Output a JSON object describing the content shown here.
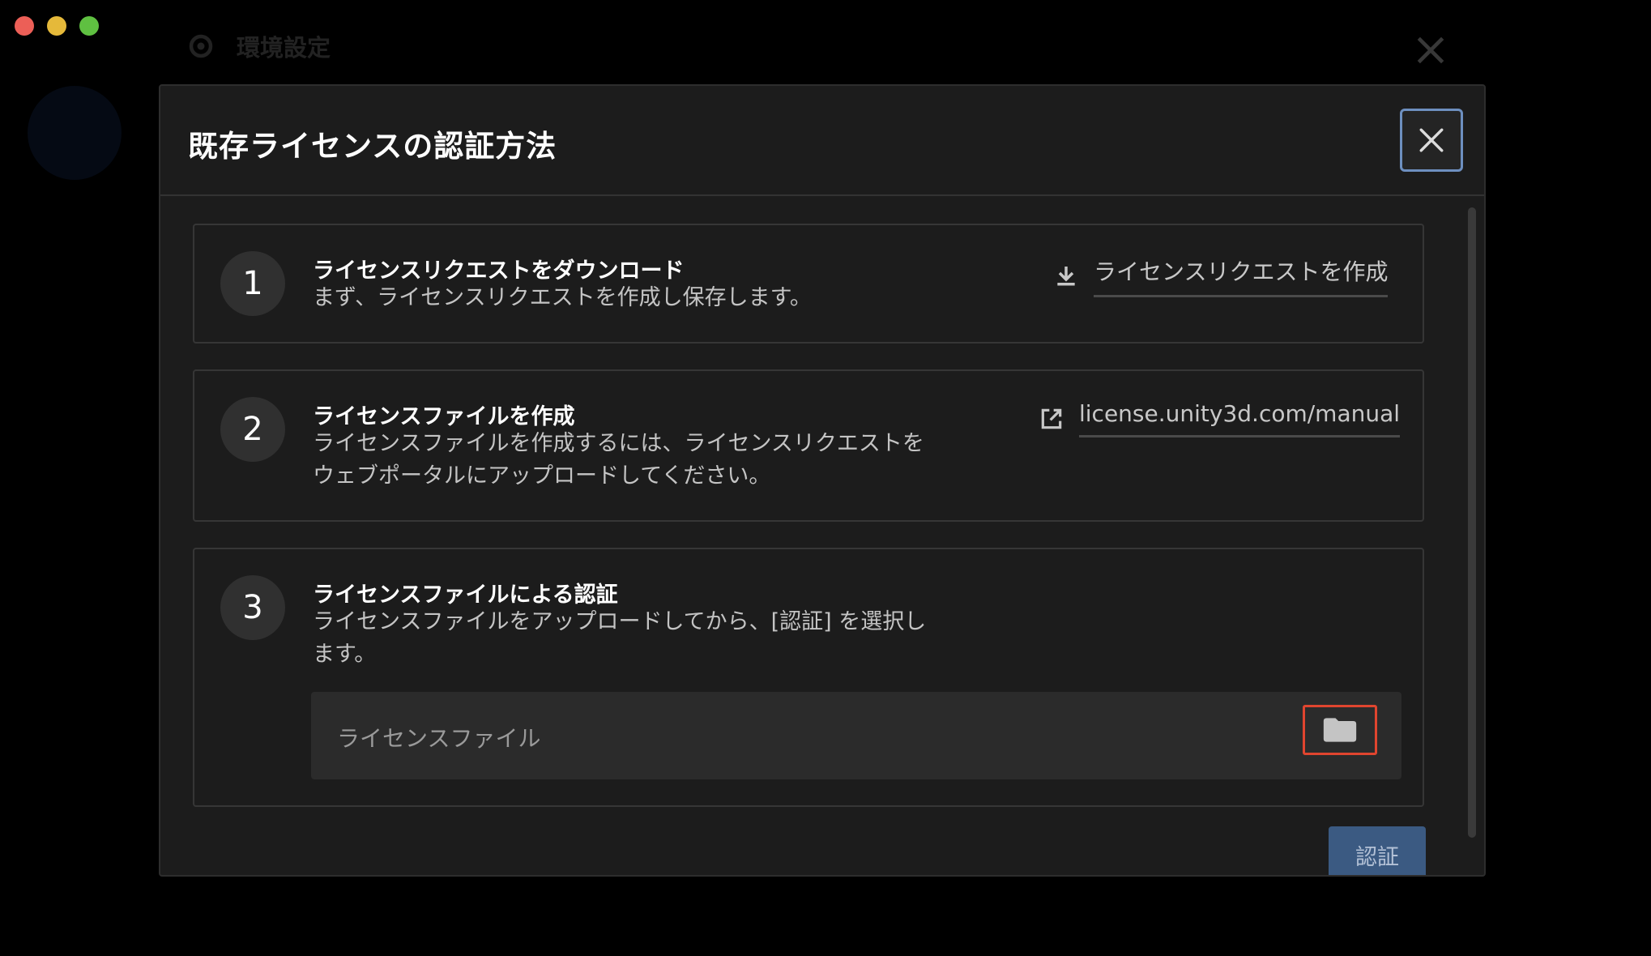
{
  "window": {
    "traffic_lights": [
      {
        "name": "close",
        "color": "#ec5f57"
      },
      {
        "name": "minimize",
        "color": "#e5b93a"
      },
      {
        "name": "zoom",
        "color": "#5fc041"
      }
    ]
  },
  "background": {
    "title": "環境設定"
  },
  "dialog": {
    "title": "既存ライセンスの認証方法",
    "steps": [
      {
        "number": "1",
        "title": "ライセンスリクエストをダウンロード",
        "description": "まず、ライセンスリクエストを作成し保存します。",
        "action_label": "ライセンスリクエストを作成",
        "action_icon": "download-icon"
      },
      {
        "number": "2",
        "title": "ライセンスファイルを作成",
        "description": "ライセンスファイルを作成するには、ライセンスリクエストをウェブポータルにアップロードしてください。",
        "action_label": "license.unity3d.com/manual",
        "action_icon": "external-link-icon"
      },
      {
        "number": "3",
        "title": "ライセンスファイルによる認証",
        "description": "ライセンスファイルをアップロードしてから、[認証] を選択します。",
        "file_placeholder": "ライセンスファイル",
        "file_icon": "folder-icon"
      }
    ],
    "submit_label": "認証"
  },
  "colors": {
    "accent_button": "#3b5a82",
    "focus_ring": "#6d8fbf",
    "highlight_box": "#e0452f"
  }
}
